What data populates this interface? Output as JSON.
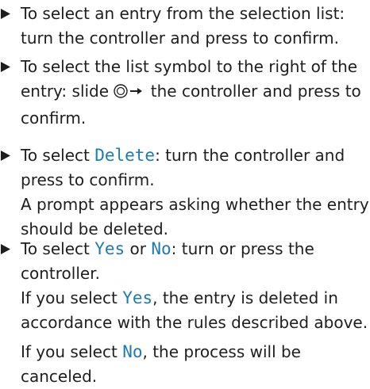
{
  "steps": [
    {
      "lines": [
        "To select an entry from the selection list:",
        "turn the controller and press to confirm."
      ]
    },
    {
      "line1": "To select the list symbol to the right of the",
      "line2_before": "entry: slide ",
      "line2_icon": "controller-slide-right-icon",
      "line2_after": " the controller and press to",
      "line3": "confirm."
    },
    {
      "line1_before": "To select ",
      "line1_keyword": "Delete",
      "line1_after": ": turn the controller and",
      "line2": "press to confirm.",
      "line3": "A prompt appears asking whether the entry",
      "line4": "should be deleted."
    },
    {
      "line1_before": "To select ",
      "line1_kw_yes": "Yes",
      "line1_mid": " or ",
      "line1_kw_no": "No",
      "line1_after": ": turn or press the",
      "line2": "controller.",
      "line3_before": "If you select ",
      "line3_kw": "Yes",
      "line3_after": ", the entry is deleted in",
      "line4": "accordance with the rules described above.",
      "line5_before": "If you select ",
      "line5_kw": "No",
      "line5_after": ", the process will be",
      "line6": "canceled."
    }
  ],
  "bullet_icon": "triangle-right-icon",
  "colors": {
    "text": "#1e1e1e",
    "keyword": "#1b7bb4"
  }
}
